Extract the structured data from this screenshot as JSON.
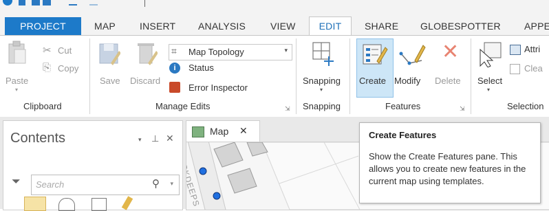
{
  "tabs": [
    {
      "label": "PROJECT"
    },
    {
      "label": "MAP"
    },
    {
      "label": "INSERT"
    },
    {
      "label": "ANALYSIS"
    },
    {
      "label": "VIEW"
    },
    {
      "label": "EDIT"
    },
    {
      "label": "SHARE"
    },
    {
      "label": "GLOBESPOTTER"
    },
    {
      "label": "APPE"
    }
  ],
  "ribbon": {
    "clipboard": {
      "paste": "Paste",
      "cut": "Cut",
      "copy": "Copy",
      "group": "Clipboard"
    },
    "manage_edits": {
      "save": "Save",
      "discard": "Discard",
      "map_topology": "Map Topology",
      "status": "Status",
      "error_inspector": "Error Inspector",
      "group": "Manage Edits"
    },
    "snapping": {
      "button": "Snapping",
      "group": "Snapping"
    },
    "features": {
      "create": "Create",
      "modify": "Modify",
      "delete": "Delete",
      "group": "Features"
    },
    "selection": {
      "select": "Select",
      "attributes": "Attri",
      "clear": "Clea",
      "group": "Selection"
    }
  },
  "contents": {
    "title": "Contents",
    "search_placeholder": "Search"
  },
  "map_tab": {
    "label": "Map"
  },
  "map_view": {
    "street_text": "RKDEEPS"
  },
  "tooltip": {
    "title": "Create Features",
    "body": "Show the Create Features pane. This allows you to create new features in the current map using templates."
  },
  "colors": {
    "accent": "#1d7ac9",
    "active_tab_text": "#1d6fb8",
    "create_highlight": "#cde6f7"
  }
}
